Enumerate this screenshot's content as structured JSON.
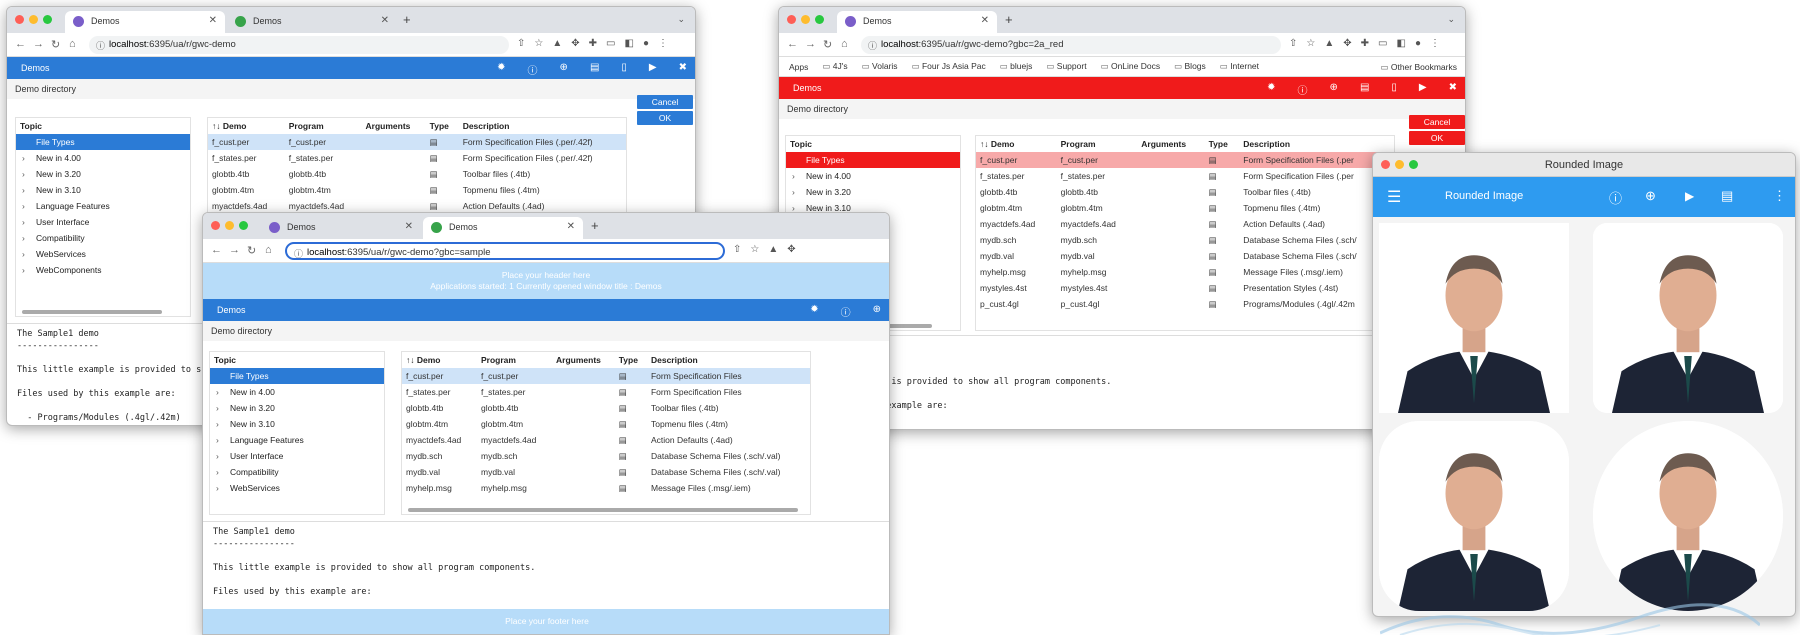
{
  "shared": {
    "tab_label": "Demos",
    "app_title": "Demos",
    "demo_directory": "Demo directory",
    "topic_header": "Topic",
    "cancel": "Cancel",
    "ok": "OK",
    "columns": [
      "↑↓ Demo",
      "Program",
      "Arguments",
      "Type",
      "Description"
    ],
    "topics": [
      "File Types",
      "New in 4.00",
      "New in 3.20",
      "New in 3.10",
      "Language Features",
      "User Interface",
      "Compatibility",
      "WebServices",
      "WebComponents"
    ],
    "doc_title": "The Sample1 demo",
    "doc_rule": "----------------",
    "doc_line1": "This little example is provided to show all program components.",
    "doc_line2": "Files used by this example are:",
    "doc_line3": "  - Programs/Modules (.4gl/.42m)"
  },
  "win1": {
    "url_host": "localhost",
    "url_rest": ":6395/ua/r/gwc-demo",
    "rows": [
      {
        "demo": "f_cust.per",
        "program": "f_cust.per",
        "desc": "Form Specification Files (.per/.42f)"
      },
      {
        "demo": "f_states.per",
        "program": "f_states.per",
        "desc": "Form Specification Files (.per/.42f)"
      },
      {
        "demo": "globtb.4tb",
        "program": "globtb.4tb",
        "desc": "Toolbar files (.4tb)"
      },
      {
        "demo": "globtm.4tm",
        "program": "globtm.4tm",
        "desc": "Topmenu files (.4tm)"
      },
      {
        "demo": "myactdefs.4ad",
        "program": "myactdefs.4ad",
        "desc": "Action Defaults (.4ad)"
      }
    ]
  },
  "win2": {
    "url_host": "localhost",
    "url_rest": ":6395/ua/r/gwc-demo?gbc=sample",
    "header_line1": "Place your header here",
    "header_line2": "Applications started: 1 Currently opened window title : Demos",
    "footer": "Place your footer here",
    "rows": [
      {
        "demo": "f_cust.per",
        "program": "f_cust.per",
        "desc": "Form Specification Files"
      },
      {
        "demo": "f_states.per",
        "program": "f_states.per",
        "desc": "Form Specification Files"
      },
      {
        "demo": "globtb.4tb",
        "program": "globtb.4tb",
        "desc": "Toolbar files (.4tb)"
      },
      {
        "demo": "globtm.4tm",
        "program": "globtm.4tm",
        "desc": "Topmenu files (.4tm)"
      },
      {
        "demo": "myactdefs.4ad",
        "program": "myactdefs.4ad",
        "desc": "Action Defaults (.4ad)"
      },
      {
        "demo": "mydb.sch",
        "program": "mydb.sch",
        "desc": "Database Schema Files (.sch/.val)"
      },
      {
        "demo": "mydb.val",
        "program": "mydb.val",
        "desc": "Database Schema Files (.sch/.val)"
      },
      {
        "demo": "myhelp.msg",
        "program": "myhelp.msg",
        "desc": "Message Files (.msg/.iem)"
      }
    ]
  },
  "win3": {
    "url_host": "localhost",
    "url_rest": ":6395/ua/r/gwc-demo?gbc=2a_red",
    "bookmarks": [
      "Apps",
      "4J's",
      "Volaris",
      "Four Js Asia Pac",
      "bluejs",
      "Support",
      "OnLine Docs",
      "Blogs",
      "Internet"
    ],
    "other_bookmarks": "Other Bookmarks",
    "rows": [
      {
        "demo": "f_cust.per",
        "program": "f_cust.per",
        "desc": "Form Specification Files (.per"
      },
      {
        "demo": "f_states.per",
        "program": "f_states.per",
        "desc": "Form Specification Files (.per"
      },
      {
        "demo": "globtb.4tb",
        "program": "globtb.4tb",
        "desc": "Toolbar files (.4tb)"
      },
      {
        "demo": "globtm.4tm",
        "program": "globtm.4tm",
        "desc": "Topmenu files (.4tm)"
      },
      {
        "demo": "myactdefs.4ad",
        "program": "myactdefs.4ad",
        "desc": "Action Defaults (.4ad)"
      },
      {
        "demo": "mydb.sch",
        "program": "mydb.sch",
        "desc": "Database Schema Files (.sch/"
      },
      {
        "demo": "mydb.val",
        "program": "mydb.val",
        "desc": "Database Schema Files (.sch/"
      },
      {
        "demo": "myhelp.msg",
        "program": "myhelp.msg",
        "desc": "Message Files (.msg/.iem)"
      },
      {
        "demo": "mystyles.4st",
        "program": "mystyles.4st",
        "desc": "Presentation Styles (.4st)"
      },
      {
        "demo": "p_cust.4gl",
        "program": "p_cust.4gl",
        "desc": "Programs/Modules (.4gl/.42m"
      }
    ]
  },
  "win4": {
    "window_title": "Rounded Image",
    "app_title": "Rounded Image"
  },
  "colors": {
    "gbc_blue": "#2b7bd6",
    "red_theme": "#f01b1b",
    "material_blue": "#2e9bf0",
    "row_highlight": "#cfe3f8"
  },
  "icons": [
    "gear-icon",
    "info-icon",
    "globe-icon",
    "document-icon",
    "page-icon",
    "play-icon",
    "close-icon",
    "menu-icon",
    "more-vert-icon"
  ]
}
